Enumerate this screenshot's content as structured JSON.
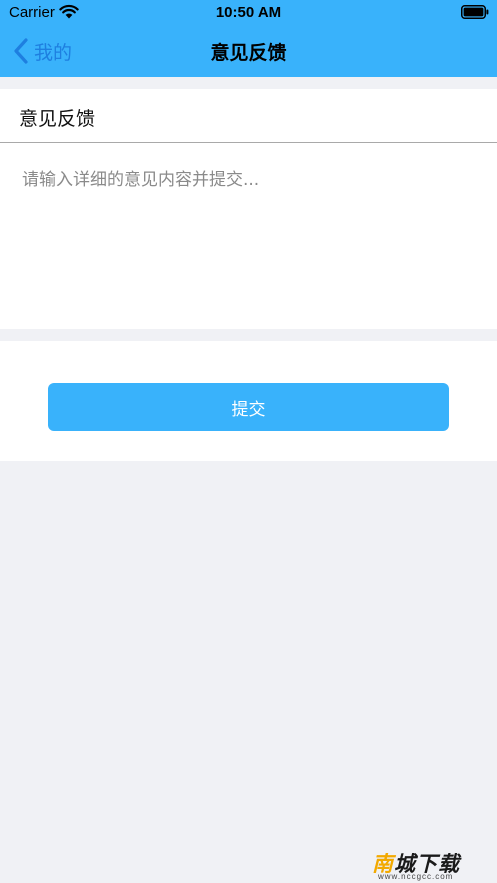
{
  "status_bar": {
    "carrier": "Carrier",
    "time": "10:50 AM",
    "wifi_icon": "wifi-icon",
    "battery_icon": "battery-icon"
  },
  "nav": {
    "back_label": "我的",
    "back_icon": "chevron-left-icon",
    "title": "意见反馈"
  },
  "form": {
    "section_title": "意见反馈",
    "feedback_value": "",
    "feedback_placeholder": "请输入详细的意见内容并提交...",
    "submit_label": "提交"
  },
  "watermark": {
    "text_accent": "南",
    "text_rest": "城下载",
    "url": "www.nccgcc.com"
  },
  "colors": {
    "brand": "#39b2fb",
    "back_link": "#1e7fe0",
    "background": "#f0f1f5"
  }
}
